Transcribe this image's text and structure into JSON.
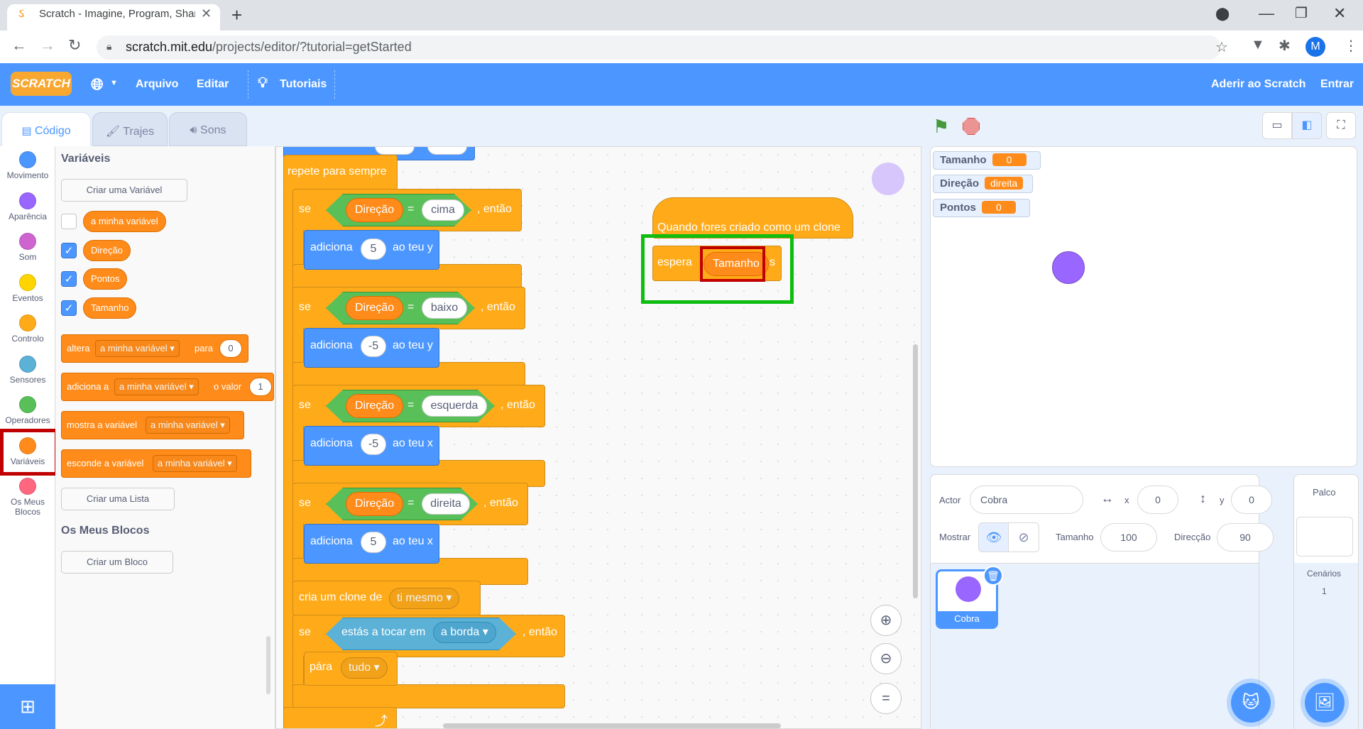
{
  "browser": {
    "tab_title": "Scratch - Imagine, Program, Share",
    "tab_close": "✕",
    "new_tab": "+",
    "url_host": "scratch.mit.edu",
    "url_path": "/projects/editor/?tutorial=getStarted",
    "profile_initial": "M"
  },
  "menubar": {
    "logo": "SCRATCH",
    "file": "Arquivo",
    "edit": "Editar",
    "tutorials": "Tutoriais",
    "join": "Aderir ao Scratch",
    "sign_in": "Entrar"
  },
  "editor_tabs": [
    "Código",
    "Trajes",
    "Sons"
  ],
  "categories": [
    {
      "label": "Movimento",
      "color": "#4c97ff"
    },
    {
      "label": "Aparência",
      "color": "#9966ff"
    },
    {
      "label": "Som",
      "color": "#cf63cf"
    },
    {
      "label": "Eventos",
      "color": "#ffd500"
    },
    {
      "label": "Controlo",
      "color": "#ffab19"
    },
    {
      "label": "Sensores",
      "color": "#5cb1d6"
    },
    {
      "label": "Operadores",
      "color": "#59c059"
    },
    {
      "label": "Variáveis",
      "color": "#ff8c1a"
    },
    {
      "label": "Os Meus Blocos",
      "color": "#ff6680"
    }
  ],
  "palette": {
    "title_vars": "Variáveis",
    "make_var": "Criar uma Variável",
    "variables": [
      "a minha variável",
      "Direção",
      "Pontos",
      "Tamanho"
    ],
    "set_block": {
      "a": "altera",
      "var": "a minha variável",
      "b": "para",
      "val": "0"
    },
    "change_block": {
      "a": "adiciona a",
      "var": "a minha variável",
      "b": "o valor",
      "val": "1"
    },
    "show_block": {
      "a": "mostra a variável",
      "var": "a minha variável"
    },
    "hide_block": {
      "a": "esconde a variável",
      "var": "a minha variável"
    },
    "make_list": "Criar uma Lista",
    "title_blocks": "Os Meus Blocos",
    "make_block": "Criar um Bloco"
  },
  "script": {
    "forever": "repete para sempre",
    "if": "se",
    "then": ", então",
    "var_dir": "Direção",
    "equals": "=",
    "v_up": "cima",
    "v_down": "baixo",
    "v_left": "esquerda",
    "v_right": "direita",
    "change_y": "ao teu y",
    "change_x": "ao teu x",
    "add": "adiciona",
    "n5": "5",
    "nm5": "-5",
    "clone": "cria um clone de",
    "clone_target": "ti mesmo",
    "touching": "estás a tocar em",
    "edge": "a borda",
    "stop": "pára",
    "stop_all": "tudo"
  },
  "clone_script": {
    "hat": "Quando fores criado como um clone",
    "wait": "espera",
    "var": "Tamanho",
    "unit": "s"
  },
  "monitors": [
    {
      "label": "Tamanho",
      "value": "0"
    },
    {
      "label": "Direção",
      "value": "direita"
    },
    {
      "label": "Pontos",
      "value": "0"
    }
  ],
  "sprite_info": {
    "actor_label": "Actor",
    "actor_name": "Cobra",
    "x_label": "x",
    "x": "0",
    "y_label": "y",
    "y": "0",
    "show_label": "Mostrar",
    "size_label": "Tamanho",
    "size": "100",
    "dir_label": "Direcção",
    "direction": "90",
    "sprite_name": "Cobra"
  },
  "stage_pane": {
    "title": "Palco",
    "backdrops_label": "Cenários",
    "backdrops_count": "1"
  }
}
